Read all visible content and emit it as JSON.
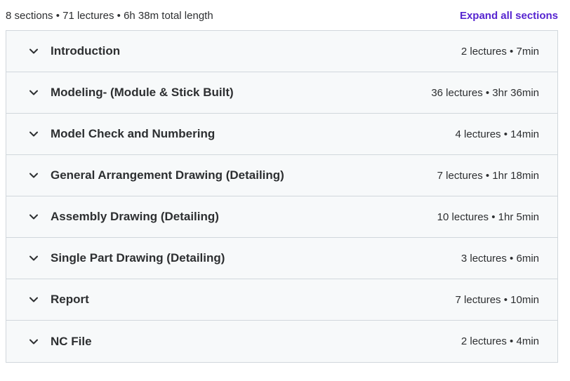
{
  "summary": {
    "text": "8 sections • 71 lectures • 6h 38m total length",
    "expand_label": "Expand all sections"
  },
  "sections": [
    {
      "title": "Introduction",
      "meta": "2 lectures • 7min"
    },
    {
      "title": "Modeling- (Module & Stick Built)",
      "meta": "36 lectures • 3hr 36min"
    },
    {
      "title": "Model Check and Numbering",
      "meta": "4 lectures • 14min"
    },
    {
      "title": "General Arrangement Drawing (Detailing)",
      "meta": "7 lectures • 1hr 18min"
    },
    {
      "title": "Assembly Drawing (Detailing)",
      "meta": "10 lectures • 1hr 5min"
    },
    {
      "title": "Single Part Drawing (Detailing)",
      "meta": "3 lectures • 6min"
    },
    {
      "title": "Report",
      "meta": "7 lectures • 10min"
    },
    {
      "title": "NC File",
      "meta": "2 lectures • 4min"
    }
  ],
  "icons": {
    "section_toggle": "chevron-down-icon"
  },
  "colors": {
    "accent": "#5624d0",
    "text": "#2d2f31",
    "section_bg": "#f7f9fa",
    "border": "#d1d7dc"
  }
}
